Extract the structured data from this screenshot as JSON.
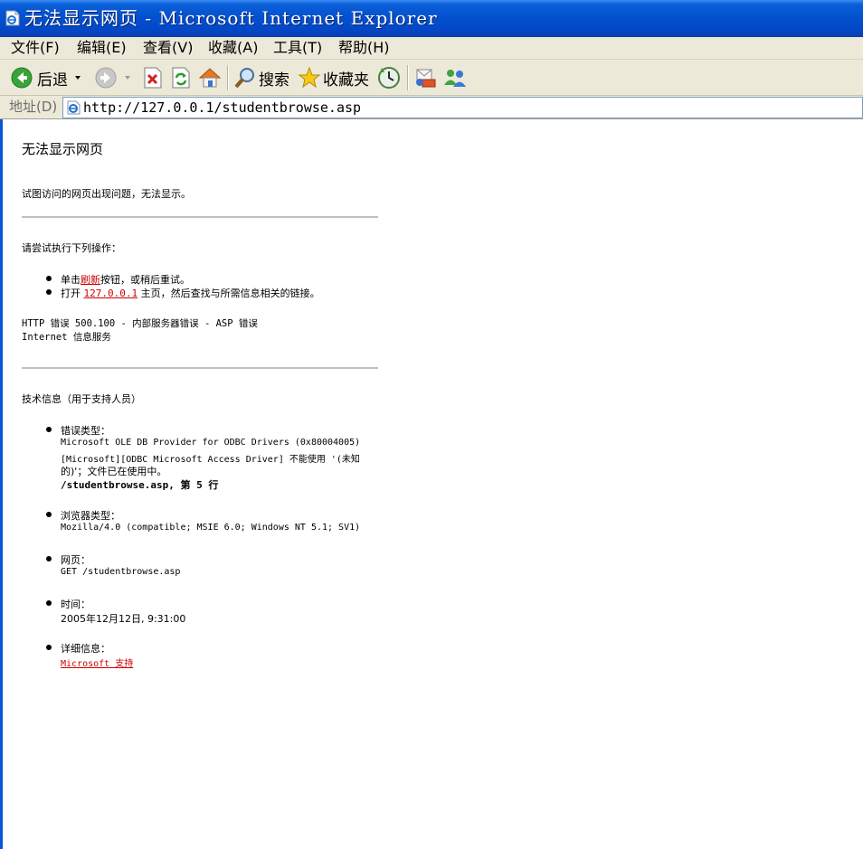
{
  "window": {
    "title": "无法显示网页 - Microsoft Internet Explorer"
  },
  "menu": {
    "items": [
      "文件(F)",
      "编辑(E)",
      "查看(V)",
      "收藏(A)",
      "工具(T)",
      "帮助(H)"
    ]
  },
  "toolbar": {
    "back_label": "后退",
    "search_label": "搜索",
    "favorites_label": "收藏夹"
  },
  "address": {
    "label": "地址(D)",
    "url": "http://127.0.0.1/studentbrowse.asp"
  },
  "page": {
    "heading": "无法显示网页",
    "intro": "试图访问的网页出现问题，无法显示。",
    "try_heading": "请尝试执行下列操作：",
    "try_item1_pre": "单击",
    "try_item1_link": "刷新",
    "try_item1_post": "按钮，或稍后重试。",
    "try_item2_pre": "打开 ",
    "try_item2_link": "127.0.0.1",
    "try_item2_post": " 主页，然后查找与所需信息相关的链接。",
    "error_line1": "HTTP 错误 500.100 - 内部服务器错误 - ASP 错误",
    "error_line2": "Internet 信息服务",
    "tech_heading": "技术信息（用于支持人员）",
    "error_type_label": "错误类型：",
    "error_type_line1": "Microsoft OLE DB Provider for ODBC Drivers (0x80004005)",
    "error_type_line2": "[Microsoft][ODBC Microsoft Access Driver] 不能使用 '(未知",
    "error_type_line3": "的)'；文件已在使用中。",
    "error_type_line4": "/studentbrowse.asp, 第 5 行",
    "browser_label": "浏览器类型：",
    "browser_value": "Mozilla/4.0 (compatible; MSIE 6.0; Windows NT 5.1; SV1)",
    "webpage_label": "网页：",
    "webpage_value": "GET /studentbrowse.asp",
    "time_label": "时间：",
    "time_value": "2005年12月12日, 9:31:00",
    "details_label": "详细信息：",
    "details_link": "Microsoft 支持"
  },
  "colors": {
    "titlebar": "#0451cf",
    "chrome": "#ece9d8",
    "link": "#cc0000"
  },
  "icons": [
    "ie-page-icon",
    "back-arrow-icon",
    "dropdown-arrow-icon",
    "forward-arrow-icon",
    "stop-icon",
    "refresh-icon",
    "home-icon",
    "search-icon",
    "favorites-star-icon",
    "history-icon",
    "mail-icon",
    "messenger-icon",
    "ie-address-icon"
  ]
}
